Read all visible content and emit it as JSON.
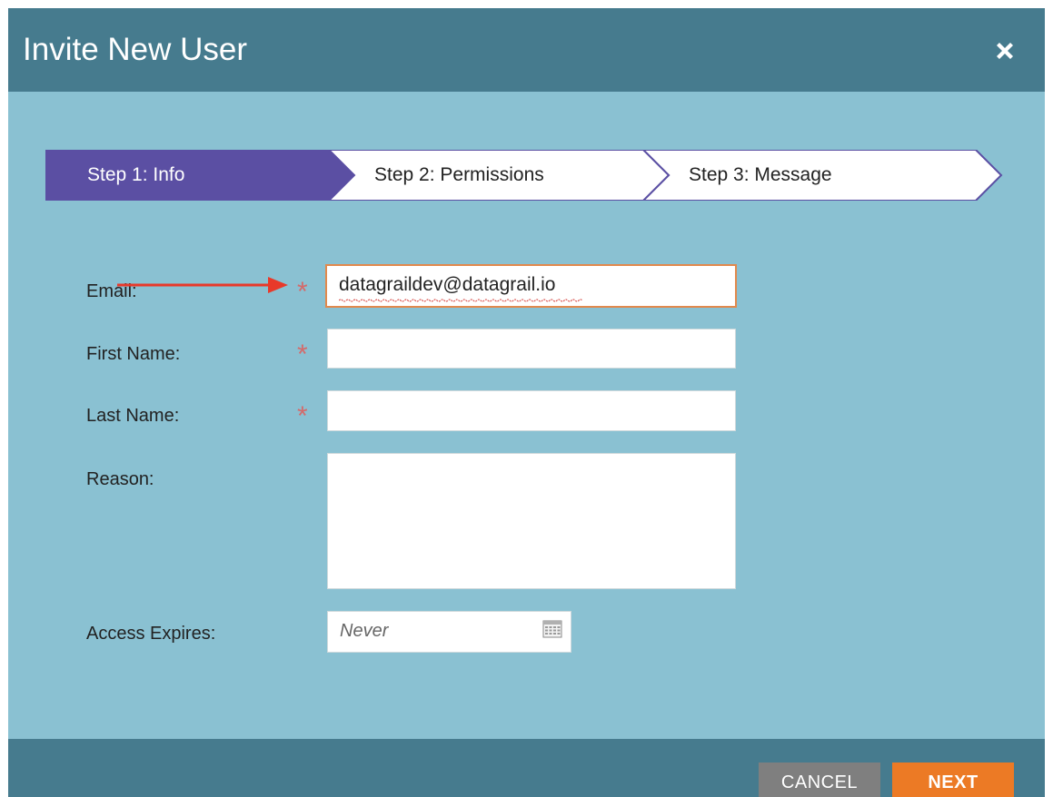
{
  "dialog": {
    "title": "Invite New User",
    "close_icon": "close-icon"
  },
  "steps": [
    {
      "label": "Step 1: Info",
      "active": true
    },
    {
      "label": "Step 2: Permissions",
      "active": false
    },
    {
      "label": "Step 3: Message",
      "active": false
    }
  ],
  "form": {
    "email": {
      "label": "Email:",
      "value": "datagraildev@datagrail.io",
      "required": true,
      "required_mark": "*"
    },
    "first_name": {
      "label": "First Name:",
      "value": "",
      "required": true,
      "required_mark": "*"
    },
    "last_name": {
      "label": "Last Name:",
      "value": "",
      "required": true,
      "required_mark": "*"
    },
    "reason": {
      "label": "Reason:",
      "value": ""
    },
    "access_expires": {
      "label": "Access Expires:",
      "value": "Never",
      "icon": "calendar-icon"
    }
  },
  "footer": {
    "cancel_label": "CANCEL",
    "next_label": "NEXT"
  },
  "colors": {
    "header": "#467b8e",
    "body": "#8ac1d2",
    "active_step": "#5b4fa3",
    "step_border": "#5b4fa3",
    "required": "#d46a6a",
    "next_button": "#ec7a25",
    "cancel_button": "#7f7f7f",
    "annotation_arrow": "#e8392a"
  }
}
